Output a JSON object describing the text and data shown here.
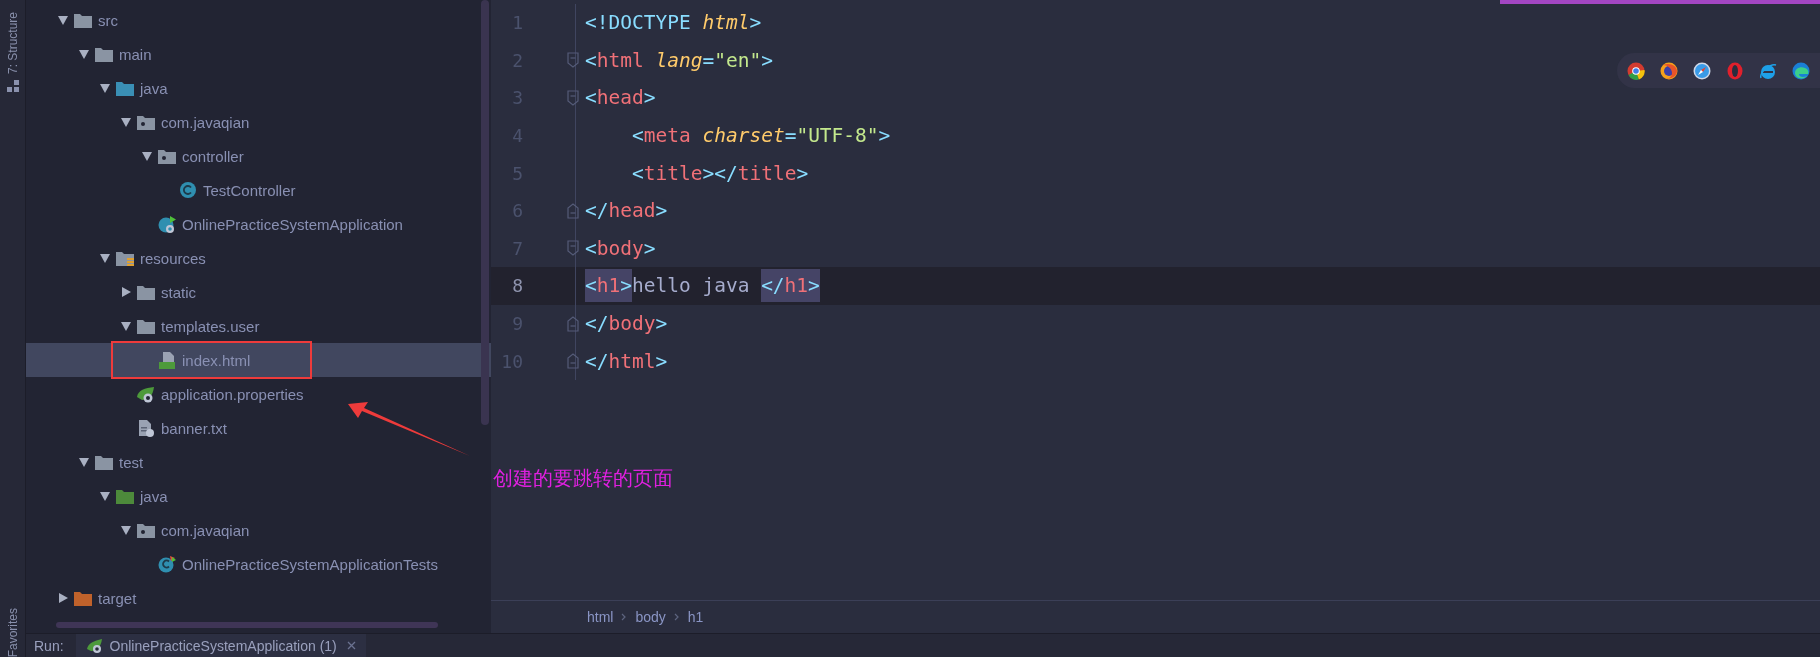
{
  "side_strip": {
    "top_label": "7: Structure",
    "bottom_label": "Favorites"
  },
  "project_tree": {
    "items": [
      {
        "label": "src",
        "kind": "folder",
        "expanded": true,
        "selected": false,
        "children": [
          {
            "label": "main",
            "kind": "folder",
            "expanded": true,
            "selected": false,
            "children": [
              {
                "label": "java",
                "kind": "source-root",
                "expanded": true,
                "selected": false,
                "children": [
                  {
                    "label": "com.javaqian",
                    "kind": "package",
                    "expanded": true,
                    "selected": false,
                    "children": [
                      {
                        "label": "controller",
                        "kind": "package",
                        "expanded": true,
                        "selected": false,
                        "children": [
                          {
                            "label": "TestController",
                            "kind": "class",
                            "selected": false
                          }
                        ]
                      },
                      {
                        "label": "OnlinePracticeSystemApplication",
                        "kind": "spring-class",
                        "selected": false
                      }
                    ]
                  }
                ]
              },
              {
                "label": "resources",
                "kind": "resources",
                "expanded": true,
                "selected": false,
                "children": [
                  {
                    "label": "static",
                    "kind": "folder",
                    "expanded": false,
                    "selected": false
                  },
                  {
                    "label": "templates.user",
                    "kind": "folder",
                    "expanded": true,
                    "selected": false,
                    "children": [
                      {
                        "label": "index.html",
                        "kind": "html-file",
                        "selected": true
                      }
                    ]
                  },
                  {
                    "label": "application.properties",
                    "kind": "spring-props",
                    "selected": false
                  },
                  {
                    "label": "banner.txt",
                    "kind": "text-file",
                    "selected": false
                  }
                ]
              }
            ]
          },
          {
            "label": "test",
            "kind": "folder",
            "expanded": true,
            "selected": false,
            "children": [
              {
                "label": "java",
                "kind": "test-root",
                "expanded": true,
                "selected": false,
                "children": [
                  {
                    "label": "com.javaqian",
                    "kind": "package",
                    "expanded": true,
                    "selected": false,
                    "children": [
                      {
                        "label": "OnlinePracticeSystemApplicationTests",
                        "kind": "test-class",
                        "selected": false
                      }
                    ]
                  }
                ]
              }
            ]
          }
        ]
      },
      {
        "label": "target",
        "kind": "excluded",
        "expanded": false,
        "selected": false
      }
    ]
  },
  "editor": {
    "lines": [
      {
        "number": "1",
        "current": false,
        "indented": false,
        "kind": "plain",
        "tokens": [
          {
            "kind": "punct",
            "text": "<!"
          },
          {
            "kind": "keyword",
            "text": "DOCTYPE "
          },
          {
            "kind": "attr",
            "text": "html"
          },
          {
            "kind": "punct",
            "text": ">"
          }
        ]
      },
      {
        "number": "2",
        "current": false,
        "indented": false,
        "kind": "fold-start",
        "tokens": [
          {
            "kind": "punct",
            "text": "<"
          },
          {
            "kind": "tag",
            "text": "html "
          },
          {
            "kind": "attr",
            "text": "lang"
          },
          {
            "kind": "punct",
            "text": "="
          },
          {
            "kind": "string",
            "text": "\"en\""
          },
          {
            "kind": "punct",
            "text": ">"
          }
        ]
      },
      {
        "number": "3",
        "current": false,
        "indented": false,
        "kind": "fold-start",
        "tokens": [
          {
            "kind": "punct",
            "text": "<"
          },
          {
            "kind": "tag",
            "text": "head"
          },
          {
            "kind": "punct",
            "text": ">"
          }
        ]
      },
      {
        "number": "4",
        "current": false,
        "indented": true,
        "kind": "plain",
        "tokens": [
          {
            "kind": "punct",
            "text": "<"
          },
          {
            "kind": "tag",
            "text": "meta "
          },
          {
            "kind": "attr",
            "text": "charset"
          },
          {
            "kind": "punct",
            "text": "="
          },
          {
            "kind": "string",
            "text": "\"UTF-8\""
          },
          {
            "kind": "punct",
            "text": ">"
          }
        ]
      },
      {
        "number": "5",
        "current": false,
        "indented": true,
        "kind": "plain",
        "tokens": [
          {
            "kind": "punct",
            "text": "<"
          },
          {
            "kind": "tag",
            "text": "title"
          },
          {
            "kind": "punct",
            "text": "></"
          },
          {
            "kind": "tag",
            "text": "title"
          },
          {
            "kind": "punct",
            "text": ">"
          }
        ]
      },
      {
        "number": "6",
        "current": false,
        "indented": false,
        "kind": "fold-end",
        "tokens": [
          {
            "kind": "punct",
            "text": "</"
          },
          {
            "kind": "tag",
            "text": "head"
          },
          {
            "kind": "punct",
            "text": ">"
          }
        ]
      },
      {
        "number": "7",
        "current": false,
        "indented": false,
        "kind": "fold-start",
        "tokens": [
          {
            "kind": "punct",
            "text": "<"
          },
          {
            "kind": "tag",
            "text": "body"
          },
          {
            "kind": "punct",
            "text": ">"
          }
        ]
      },
      {
        "number": "8",
        "current": true,
        "indented": false,
        "kind": "plain",
        "tokens": [
          {
            "kind": "match",
            "tokens": [
              {
                "kind": "punct",
                "text": "<"
              },
              {
                "kind": "tag",
                "text": "h1"
              },
              {
                "kind": "punct",
                "text": ">"
              }
            ]
          },
          {
            "kind": "text",
            "text": "hello java "
          },
          {
            "kind": "match",
            "tokens": [
              {
                "kind": "punct",
                "text": "</"
              },
              {
                "kind": "tag",
                "text": "h1"
              },
              {
                "kind": "punct",
                "text": ">"
              }
            ]
          }
        ]
      },
      {
        "number": "9",
        "current": false,
        "indented": false,
        "kind": "fold-end",
        "tokens": [
          {
            "kind": "punct",
            "text": "</"
          },
          {
            "kind": "tag",
            "text": "body"
          },
          {
            "kind": "punct",
            "text": ">"
          }
        ]
      },
      {
        "number": "10",
        "current": false,
        "indented": false,
        "kind": "fold-end",
        "tokens": [
          {
            "kind": "punct",
            "text": "</"
          },
          {
            "kind": "tag",
            "text": "html"
          },
          {
            "kind": "punct",
            "text": ">"
          }
        ]
      }
    ]
  },
  "breadcrumbs": [
    "html",
    "body",
    "h1"
  ],
  "run_bar": {
    "label": "Run:",
    "tab": "OnlinePracticeSystemApplication (1)"
  },
  "annotation": {
    "text": "创建的要跳转的页面"
  }
}
